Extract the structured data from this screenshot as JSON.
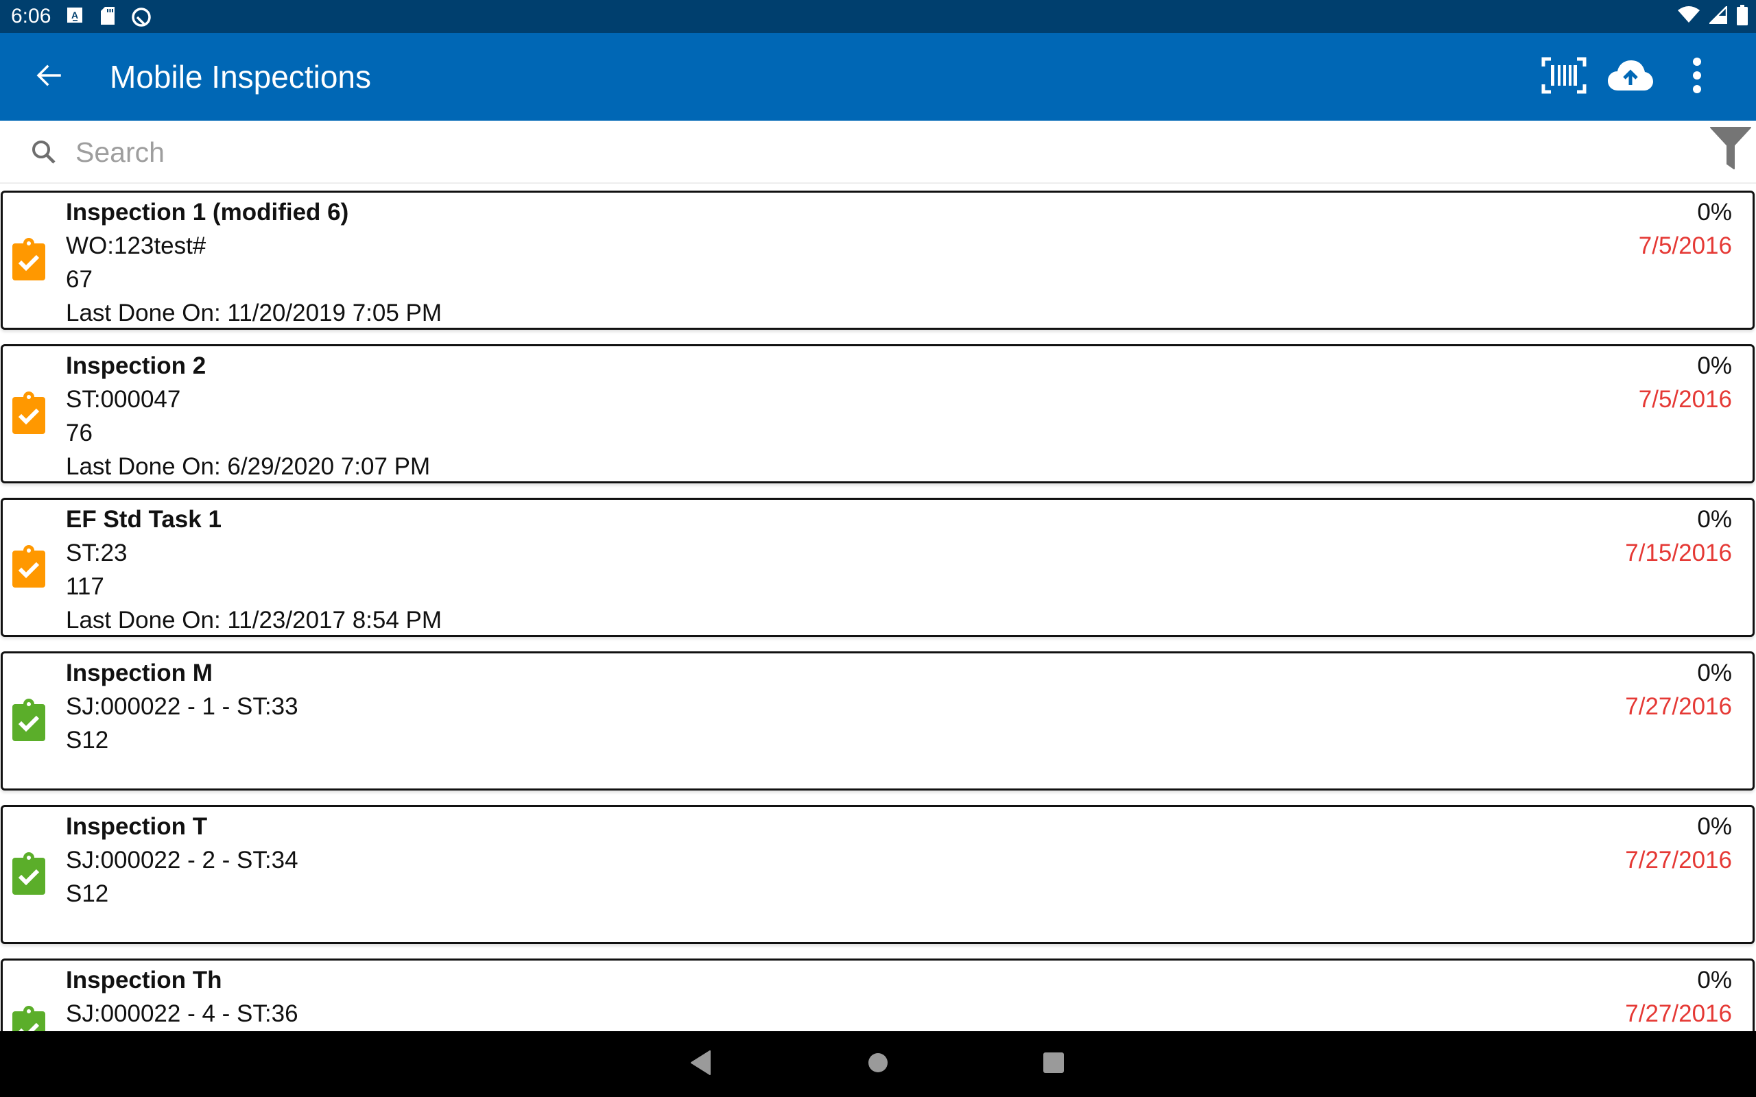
{
  "status_bar": {
    "time": "6:06",
    "left_icons": [
      "accessibility-a-icon",
      "sd-card-icon",
      "data-saver-icon"
    ],
    "right_icons": [
      "wifi-icon",
      "signal-icon",
      "battery-icon"
    ]
  },
  "toolbar": {
    "title": "Mobile Inspections",
    "back_icon": "arrow-left-icon",
    "actions": [
      {
        "name": "barcode-scan",
        "icon": "barcode-scan-icon"
      },
      {
        "name": "cloud-upload",
        "icon": "cloud-upload-icon"
      },
      {
        "name": "more-options",
        "icon": "more-vert-icon"
      }
    ],
    "colors": {
      "status_bar": "#003f6e",
      "toolbar": "#0067b5"
    }
  },
  "search": {
    "placeholder": "Search",
    "value": "",
    "filter_icon": "filter-icon"
  },
  "colors": {
    "icon_pending": "#ff9800",
    "icon_done": "#5bae2a",
    "due_date": "#e53935"
  },
  "inspections": [
    {
      "title": "Inspection 1 (modified 6)",
      "ref": "WO:123test#",
      "code": "67",
      "last_done": "Last Done On: 11/20/2019 7:05 PM",
      "percent": "0%",
      "due_date": "7/5/2016",
      "status_color": "orange"
    },
    {
      "title": "Inspection 2",
      "ref": "ST:000047",
      "code": "76",
      "last_done": "Last Done On: 6/29/2020 7:07 PM",
      "percent": "0%",
      "due_date": "7/5/2016",
      "status_color": "orange"
    },
    {
      "title": "EF Std Task 1",
      "ref": "ST:23",
      "code": "117",
      "last_done": "Last Done On: 11/23/2017 8:54 PM",
      "percent": "0%",
      "due_date": "7/15/2016",
      "status_color": "orange"
    },
    {
      "title": "Inspection M",
      "ref": "SJ:000022 - 1 - ST:33",
      "code": "S12",
      "last_done": "",
      "percent": "0%",
      "due_date": "7/27/2016",
      "status_color": "green"
    },
    {
      "title": "Inspection T",
      "ref": "SJ:000022 - 2 - ST:34",
      "code": "S12",
      "last_done": "",
      "percent": "0%",
      "due_date": "7/27/2016",
      "status_color": "green"
    },
    {
      "title": "Inspection Th",
      "ref": "SJ:000022 - 4 - ST:36",
      "code": "",
      "last_done": "",
      "percent": "0%",
      "due_date": "7/27/2016",
      "status_color": "green"
    }
  ],
  "nav_bar": {
    "buttons": [
      "back-triangle-icon",
      "home-circle-icon",
      "recents-square-icon"
    ]
  }
}
